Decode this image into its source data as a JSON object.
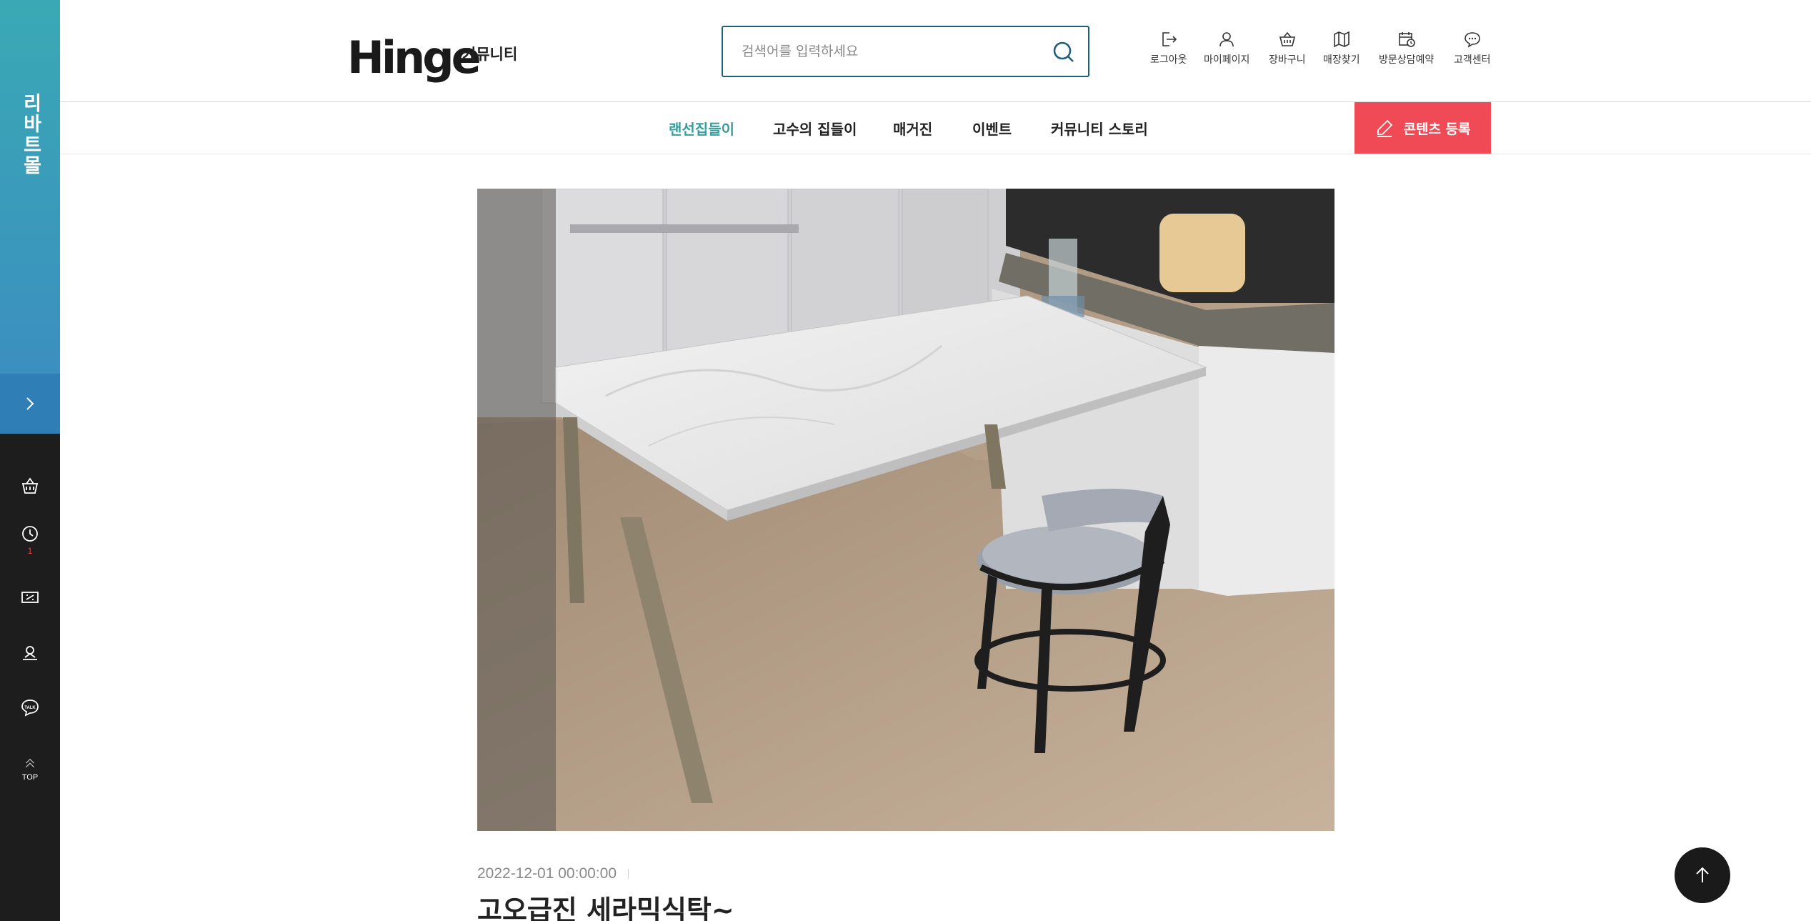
{
  "sidebar": {
    "banner_text": "리바트몰",
    "recent_count": "1",
    "top_label": "TOP",
    "icons": [
      "toggle-chevron-right-icon",
      "basket-icon",
      "clock-icon",
      "coupon-icon",
      "store-location-icon",
      "talk-icon",
      "top-arrow-icon"
    ]
  },
  "header": {
    "logo_prefix": "Hi",
    "logo_mid": "n",
    "logo_suffix": "ge",
    "logo_sub": "커뮤니티",
    "search_placeholder": "검색어를 입력하세요",
    "utils": [
      {
        "label": "로그아웃",
        "icon": "logout-icon"
      },
      {
        "label": "마이페이지",
        "icon": "user-icon"
      },
      {
        "label": "장바구니",
        "icon": "basket-icon"
      },
      {
        "label": "매장찾기",
        "icon": "map-icon"
      },
      {
        "label": "방문상담예약",
        "icon": "calendar-clock-icon"
      },
      {
        "label": "고객센터",
        "icon": "chat-icon"
      }
    ]
  },
  "nav": {
    "items": [
      "랜선집들이",
      "고수의 집들이",
      "매거진",
      "이벤트",
      "커뮤니티 스토리"
    ],
    "active_index": 0,
    "register_label": "콘텐츠 등록"
  },
  "post": {
    "date": "2022-12-01 00:00:00",
    "title": "고오급진 세라믹식탁~"
  },
  "colors": {
    "accent_teal": "#3a9c9c",
    "register_red": "#ef4a55",
    "sidebar_dark": "#1d1d1d",
    "banner_top": "#3aa9b5",
    "badge_red": "#e8423f"
  }
}
